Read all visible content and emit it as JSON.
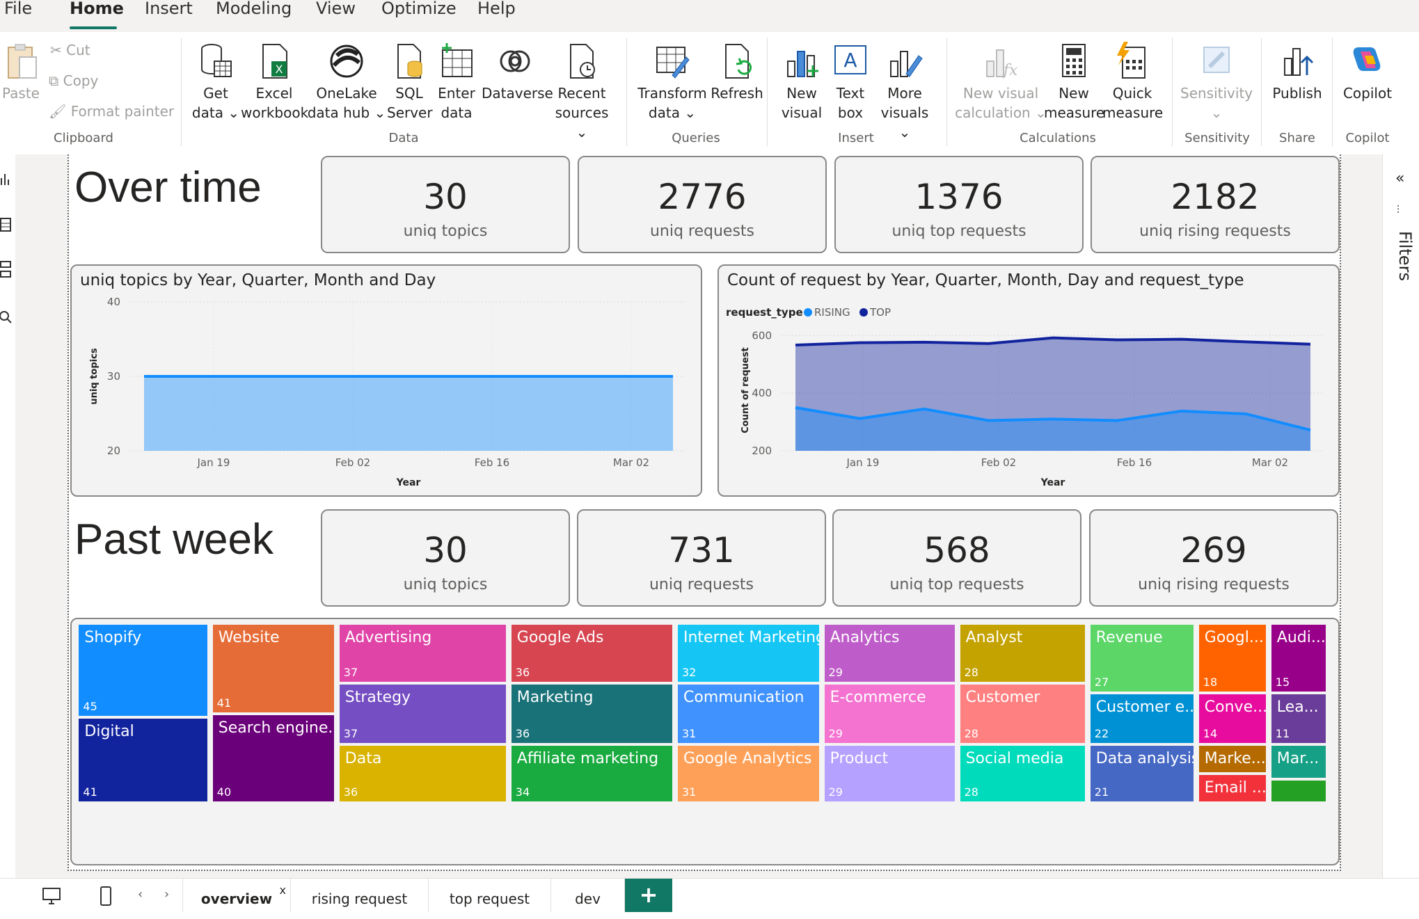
{
  "menu": {
    "items": [
      "File",
      "Home",
      "Insert",
      "Modeling",
      "View",
      "Optimize",
      "Help"
    ],
    "active": "Home"
  },
  "ribbon": {
    "clipboard": {
      "paste": "Paste",
      "cut": "Cut",
      "copy": "Copy",
      "format_painter": "Format painter",
      "label": "Clipboard"
    },
    "data": {
      "get_data": [
        "Get",
        "data"
      ],
      "excel": [
        "Excel",
        "workbook"
      ],
      "onelake": [
        "OneLake",
        "data hub"
      ],
      "sql": [
        "SQL",
        "Server"
      ],
      "enter": [
        "Enter",
        "data"
      ],
      "dataverse": [
        "Dataverse"
      ],
      "recent": [
        "Recent",
        "sources"
      ],
      "label": "Data"
    },
    "queries": {
      "transform": [
        "Transform",
        "data"
      ],
      "refresh": [
        "Refresh"
      ],
      "label": "Queries"
    },
    "insert": {
      "new_visual": [
        "New",
        "visual"
      ],
      "text_box": [
        "Text",
        "box"
      ],
      "more_visuals": [
        "More",
        "visuals"
      ],
      "label": "Insert"
    },
    "calculations": {
      "new_visual_calc": [
        "New visual",
        "calculation"
      ],
      "new_measure": [
        "New",
        "measure"
      ],
      "quick_measure": [
        "Quick",
        "measure"
      ],
      "label": "Calculations"
    },
    "sensitivity": {
      "btn": [
        "Sensitivity"
      ],
      "label": "Sensitivity"
    },
    "share": {
      "btn": [
        "Publish"
      ],
      "label": "Share"
    },
    "copilot": {
      "btn": [
        "Copilot"
      ],
      "label": "Copilot"
    }
  },
  "filters_label": "Filters",
  "over_time": {
    "title": "Over time",
    "cards": [
      {
        "value": "30",
        "label": "uniq topics"
      },
      {
        "value": "2776",
        "label": "uniq requests"
      },
      {
        "value": "1376",
        "label": "uniq top requests"
      },
      {
        "value": "2182",
        "label": "uniq rising requests"
      }
    ]
  },
  "past_week": {
    "title": "Past week",
    "cards": [
      {
        "value": "30",
        "label": "uniq topics"
      },
      {
        "value": "731",
        "label": "uniq requests"
      },
      {
        "value": "568",
        "label": "uniq top requests"
      },
      {
        "value": "269",
        "label": "uniq rising requests"
      }
    ]
  },
  "chart_data": [
    {
      "type": "area",
      "title": "uniq topics by Year, Quarter, Month and Day",
      "xlabel": "Year",
      "ylabel": "uniq topics",
      "x_ticks": [
        "Jan 19",
        "Feb 02",
        "Feb 16",
        "Mar 02"
      ],
      "y_ticks": [
        20,
        30,
        40
      ],
      "ylim": [
        20,
        40
      ],
      "x": [
        "Jan 12",
        "Mar 12"
      ],
      "series": [
        {
          "values": [
            30,
            30
          ],
          "color": "#118DFF"
        }
      ]
    },
    {
      "type": "area",
      "title": "Count of request by Year, Quarter, Month, Day and request_type",
      "legend_title": "request_type",
      "legend": "top-left",
      "xlabel": "Year",
      "ylabel": "Count of request",
      "x_ticks": [
        "Jan 19",
        "Feb 02",
        "Feb 16",
        "Mar 02"
      ],
      "y_ticks": [
        200,
        400,
        600
      ],
      "ylim": [
        200,
        620
      ],
      "x": [
        "Jan 12",
        "Jan 19",
        "Jan 26",
        "Feb 02",
        "Feb 09",
        "Feb 16",
        "Feb 23",
        "Mar 02",
        "Mar 09"
      ],
      "series": [
        {
          "name": "RISING",
          "color": "#118DFF",
          "values": [
            350,
            312,
            345,
            305,
            310,
            305,
            338,
            328,
            272
          ]
        },
        {
          "name": "TOP",
          "color": "#12239E",
          "values": [
            567,
            575,
            577,
            572,
            592,
            585,
            587,
            578,
            570
          ]
        }
      ]
    },
    {
      "type": "treemap",
      "items": [
        {
          "label": "Shopify",
          "value": 45,
          "color": "#118DFF"
        },
        {
          "label": "Digital",
          "value": 41,
          "color": "#12239E"
        },
        {
          "label": "Website",
          "value": 41,
          "color": "#E66C37"
        },
        {
          "label": "Search engine...",
          "value": 40,
          "color": "#6B007B"
        },
        {
          "label": "Advertising",
          "value": 37,
          "color": "#E044A7"
        },
        {
          "label": "Strategy",
          "value": 37,
          "color": "#744EC2"
        },
        {
          "label": "Data",
          "value": 36,
          "color": "#D9B300"
        },
        {
          "label": "Google Ads",
          "value": 36,
          "color": "#D64550"
        },
        {
          "label": "Marketing",
          "value": 36,
          "color": "#197278"
        },
        {
          "label": "Affiliate marketing",
          "value": 34,
          "color": "#1AAB40"
        },
        {
          "label": "Internet Marketing",
          "value": 32,
          "color": "#15C6F4"
        },
        {
          "label": "Communication",
          "value": 31,
          "color": "#4092FF"
        },
        {
          "label": "Google Analytics",
          "value": 31,
          "color": "#FFA058"
        },
        {
          "label": "Analytics",
          "value": 29,
          "color": "#BE5DC9"
        },
        {
          "label": "E-commerce",
          "value": 29,
          "color": "#F472D0"
        },
        {
          "label": "Product",
          "value": 29,
          "color": "#B5A1FF"
        },
        {
          "label": "Analyst",
          "value": 28,
          "color": "#C4A200"
        },
        {
          "label": "Customer",
          "value": 28,
          "color": "#FF8080"
        },
        {
          "label": "Social media",
          "value": 28,
          "color": "#00DBBC"
        },
        {
          "label": "Revenue",
          "value": 27,
          "color": "#5BD667"
        },
        {
          "label": "Customer e...",
          "value": 22,
          "color": "#0091D5"
        },
        {
          "label": "Data analysis",
          "value": 21,
          "color": "#4668C5"
        },
        {
          "label": "Googl...",
          "value": 18,
          "color": "#FF6300"
        },
        {
          "label": "Conve...",
          "value": 14,
          "color": "#E70C9E"
        },
        {
          "label": "Marke...",
          "value": "",
          "color": "#B56A00"
        },
        {
          "label": "Email ...",
          "value": "",
          "color": "#F2313B"
        },
        {
          "label": "Audi...",
          "value": 15,
          "color": "#99008A"
        },
        {
          "label": "Lea...",
          "value": 11,
          "color": "#6A3D9A"
        },
        {
          "label": "Mar...",
          "value": "",
          "color": "#16A085"
        },
        {
          "label": "",
          "value": "",
          "color": "#24A024"
        }
      ]
    }
  ],
  "tabs": [
    "overview",
    "rising request",
    "top request",
    "dev"
  ],
  "active_tab": "overview",
  "tab_close": "x",
  "add_tab": "+"
}
